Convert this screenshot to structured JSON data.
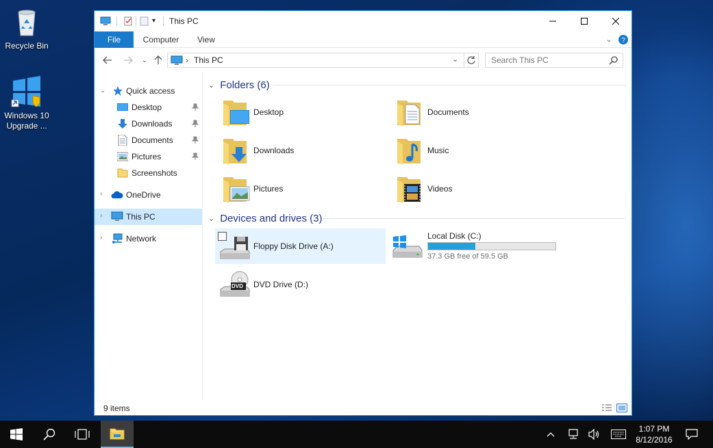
{
  "desktop": {
    "icons": [
      {
        "label": "Recycle Bin"
      },
      {
        "label": "Windows 10 Upgrade ..."
      }
    ]
  },
  "window": {
    "title": "This PC",
    "ribbon_tabs": [
      "File",
      "Computer",
      "View"
    ],
    "address": {
      "crumb": "This PC"
    },
    "search": {
      "placeholder": "Search This PC"
    }
  },
  "navpane": {
    "items": [
      {
        "label": "Quick access",
        "icon": "star-icon"
      },
      {
        "label": "Desktop",
        "icon": "desktop-icon",
        "pinned": true
      },
      {
        "label": "Downloads",
        "icon": "download-icon",
        "pinned": true
      },
      {
        "label": "Documents",
        "icon": "document-icon",
        "pinned": true
      },
      {
        "label": "Pictures",
        "icon": "picture-icon",
        "pinned": true
      },
      {
        "label": "Screenshots",
        "icon": "folder-icon"
      },
      {
        "label": "OneDrive",
        "icon": "cloud-icon"
      },
      {
        "label": "This PC",
        "icon": "computer-icon",
        "selected": true
      },
      {
        "label": "Network",
        "icon": "network-icon"
      }
    ]
  },
  "content": {
    "folders_header": "Folders (6)",
    "folders": [
      {
        "label": "Desktop"
      },
      {
        "label": "Documents"
      },
      {
        "label": "Downloads"
      },
      {
        "label": "Music"
      },
      {
        "label": "Pictures"
      },
      {
        "label": "Videos"
      }
    ],
    "drives_header": "Devices and drives (3)",
    "drives": [
      {
        "label": "Floppy Disk Drive (A:)"
      },
      {
        "label": "Local Disk (C:)",
        "free_text": "37.3 GB free of 59.5 GB",
        "used_fraction": 0.373
      },
      {
        "label": "DVD Drive (D:)",
        "badge": "DVD"
      }
    ]
  },
  "statusbar": {
    "item_count": "9 items"
  },
  "taskbar": {
    "time": "1:07 PM",
    "date": "8/12/2016"
  },
  "colors": {
    "accent": "#1979ca",
    "selection": "#cce8ff",
    "group_header": "#1e3287",
    "drive_bar": "#26a0da"
  }
}
